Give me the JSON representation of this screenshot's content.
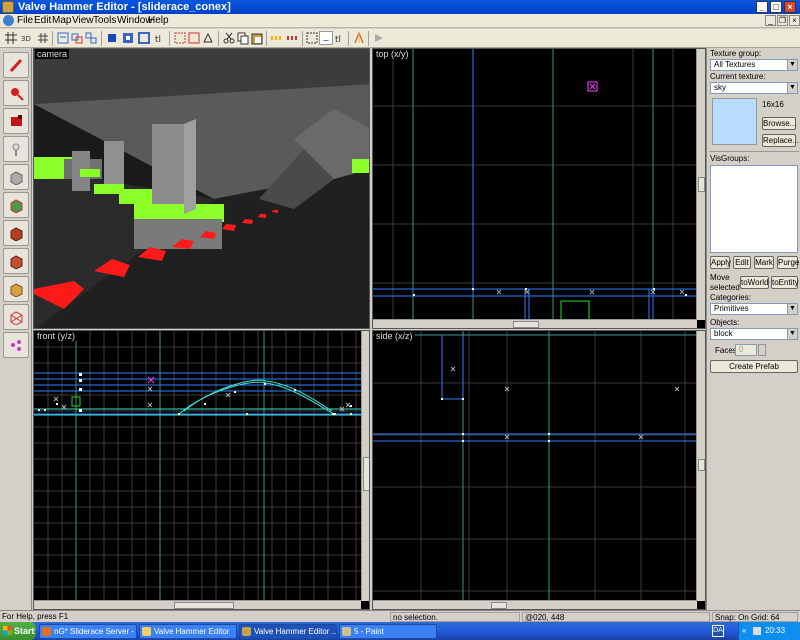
{
  "window": {
    "title": "Valve Hammer Editor - [sliderace_conex]"
  },
  "window_buttons": {
    "minimize": "_",
    "maximize": "□",
    "close": "×"
  },
  "mdi_buttons": {
    "minimize": "_",
    "restore": "❐",
    "close": "×"
  },
  "menu": [
    "File",
    "Edit",
    "Map",
    "View",
    "Tools",
    "Window",
    "Help"
  ],
  "viewports": {
    "camera": "camera",
    "top": "top (x/y)",
    "front": "front (y/z)",
    "side": "side (x/z)"
  },
  "panel": {
    "texture_group_label": "Texture group:",
    "texture_group_value": "All Textures",
    "current_texture_label": "Current texture:",
    "current_texture_value": "sky",
    "texture_size": "16x16",
    "browse": "Browse...",
    "replace": "Replace...",
    "visgroups_label": "VisGroups:",
    "apply": "Apply",
    "edit": "Edit",
    "mark": "Mark",
    "purge": "Purge",
    "move_selected": "Move selected",
    "to_world": "toWorld",
    "to_entity": "toEntity",
    "categories_label": "Categories:",
    "categories_value": "Primitives",
    "objects_label": "Objects:",
    "objects_value": "block",
    "faces_label": "Faces:",
    "faces_value": "0",
    "create_prefab": "Create Prefab"
  },
  "status": {
    "help": "For Help, press F1",
    "selection": "no selection.",
    "coords": "@020, 448",
    "snap": "Snap: On Grid: 64"
  },
  "taskbar": {
    "start": "Start",
    "tasks": [
      "nG* Sliderace Server - M...",
      "Valve Hammer Editor",
      "Valve Hammer Editor ...",
      "5 - Paint"
    ],
    "tray_lang": "DA",
    "clock": "20:33"
  },
  "colors": {
    "title_blue": "#0a58e0",
    "grid_line": "#4a4a4a",
    "axis_line": "#3f8f8f",
    "brush_blue": "#2f7fff",
    "brush_cyan": "#40e0d0",
    "lime": "#8cff2a",
    "arrow_red": "#ff1a1a",
    "texture_swatch": "#b8dcff",
    "entity_magenta": "#ff40ff"
  },
  "icons": {
    "tools": [
      "selection-pointer-icon",
      "magnify-icon",
      "camera-icon",
      "entity-icon",
      "block-icon",
      "texture-application-icon",
      "apply-current-texture-icon",
      "decal-icon",
      "overlay-icon",
      "clipping-icon",
      "vertex-manipulation-icon"
    ]
  }
}
